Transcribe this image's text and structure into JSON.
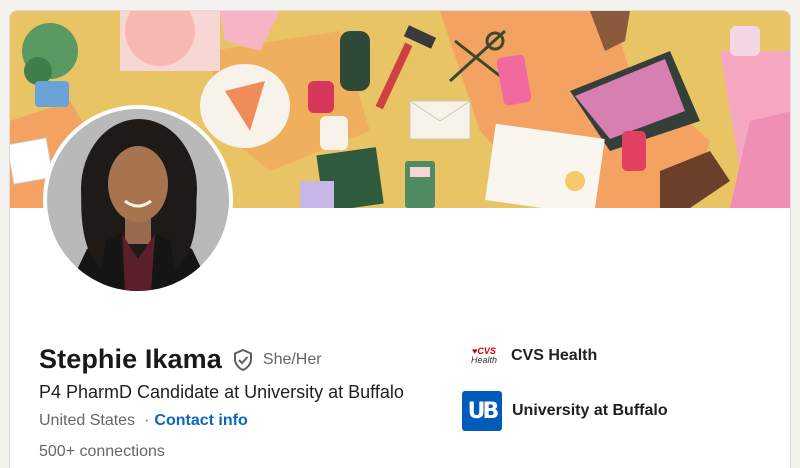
{
  "profile": {
    "name": "Stephie Ikama",
    "pronouns": "She/Her",
    "headline": "P4 PharmD Candidate at University at Buffalo",
    "location": "United States",
    "separator": "·",
    "contact_label": "Contact info",
    "connections": "500+ connections"
  },
  "organizations": [
    {
      "name": "CVS Health",
      "logo_text_top": "♥CVS",
      "logo_text_bottom": "Health",
      "logo_color": "#cc0000"
    },
    {
      "name": "University at Buffalo",
      "logo_text": "UB",
      "logo_color": "#005bbb"
    }
  ],
  "colors": {
    "link": "#0a66c2",
    "banner_yellow": "#e9c46a",
    "banner_orange": "#f4a261"
  },
  "icons": {
    "verify": "shield-check-icon"
  }
}
